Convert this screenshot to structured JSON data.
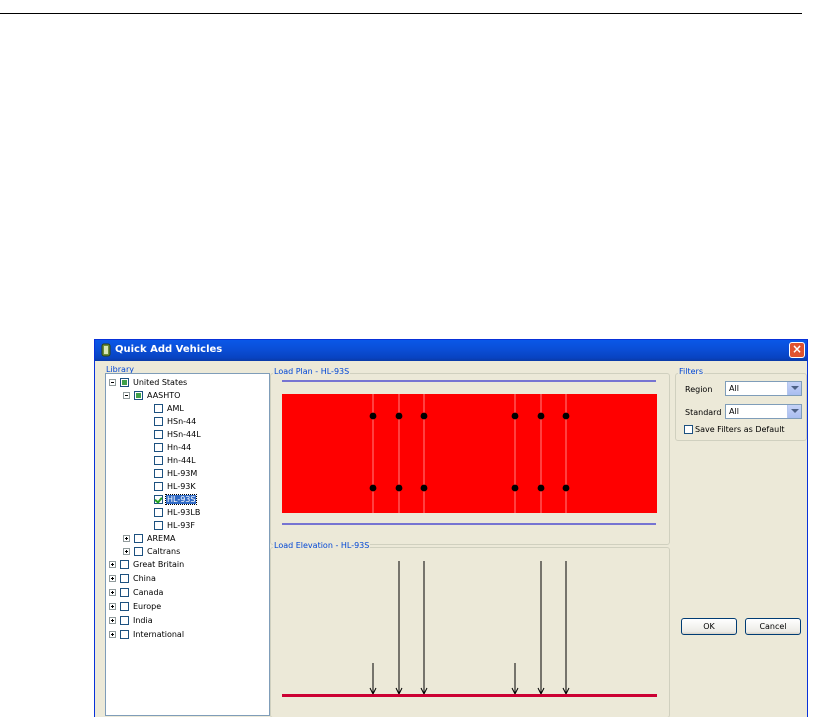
{
  "window": {
    "title": "Quick Add Vehicles",
    "close_glyph": "×"
  },
  "library": {
    "group_title": "Library",
    "items": [
      {
        "label": "United States",
        "expander": "minus",
        "check": "partial",
        "selected": false
      },
      {
        "label": "AASHTO",
        "expander": "minus",
        "check": "partial",
        "selected": false
      },
      {
        "label": "AML",
        "expander": "none",
        "check": "unchecked",
        "selected": false
      },
      {
        "label": "HSn-44",
        "expander": "none",
        "check": "unchecked",
        "selected": false
      },
      {
        "label": "HSn-44L",
        "expander": "none",
        "check": "unchecked",
        "selected": false
      },
      {
        "label": "Hn-44",
        "expander": "none",
        "check": "unchecked",
        "selected": false
      },
      {
        "label": "Hn-44L",
        "expander": "none",
        "check": "unchecked",
        "selected": false
      },
      {
        "label": "HL-93M",
        "expander": "none",
        "check": "unchecked",
        "selected": false
      },
      {
        "label": "HL-93K",
        "expander": "none",
        "check": "unchecked",
        "selected": false
      },
      {
        "label": "HL-93S",
        "expander": "none",
        "check": "checked",
        "selected": true
      },
      {
        "label": "HL-93LB",
        "expander": "none",
        "check": "unchecked",
        "selected": false
      },
      {
        "label": "HL-93F",
        "expander": "none",
        "check": "unchecked",
        "selected": false
      },
      {
        "label": "AREMA",
        "expander": "plus",
        "check": "unchecked",
        "selected": false
      },
      {
        "label": "Caltrans",
        "expander": "plus",
        "check": "unchecked",
        "selected": false
      },
      {
        "label": "Great Britain",
        "expander": "plus",
        "check": "unchecked",
        "selected": false
      },
      {
        "label": "China",
        "expander": "plus",
        "check": "unchecked",
        "selected": false
      },
      {
        "label": "Canada",
        "expander": "plus",
        "check": "unchecked",
        "selected": false
      },
      {
        "label": "Europe",
        "expander": "plus",
        "check": "unchecked",
        "selected": false
      },
      {
        "label": "India",
        "expander": "plus",
        "check": "unchecked",
        "selected": false
      },
      {
        "label": "International",
        "expander": "plus",
        "check": "unchecked",
        "selected": false
      }
    ]
  },
  "load_plan": {
    "group_title": "Load Plan - HL-93S",
    "deck_color": "#ff0000",
    "line_color": "#0000cc"
  },
  "load_elevation": {
    "group_title": "Load Elevation - HL-93S",
    "ground_color": "#cc0033"
  },
  "filters": {
    "group_title": "Filters",
    "region_label": "Region",
    "region_value": "All",
    "standard_label": "Standard",
    "standard_value": "All",
    "save_default_label": "Save Filters as Default",
    "save_default_checked": false
  },
  "buttons": {
    "ok_label": "OK",
    "cancel_label": "Cancel"
  }
}
